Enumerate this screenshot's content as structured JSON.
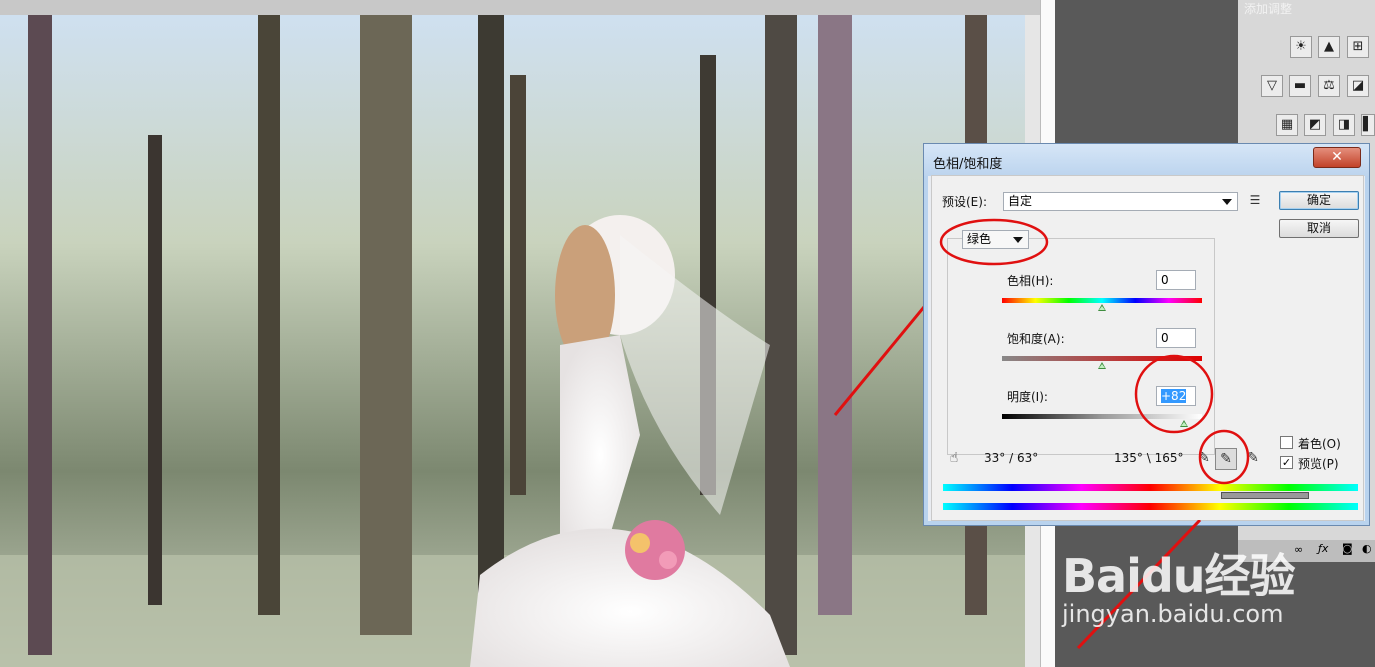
{
  "panel": {
    "title": "添加调整"
  },
  "dialog": {
    "title": "色相/饱和度",
    "close_icon": "✕",
    "preset_label": "预设(E):",
    "preset_value": "自定",
    "ok_label": "确定",
    "cancel_label": "取消",
    "channel_value": "绿色",
    "hue_label": "色相(H):",
    "hue_value": "0",
    "saturation_label": "饱和度(A):",
    "saturation_value": "0",
    "lightness_label": "明度(I):",
    "lightness_value": "+82",
    "hue_pos": 0.5,
    "saturation_pos": 0.5,
    "lightness_pos": 0.91,
    "range_left": "33° / 63°",
    "range_right": "135° \\ 165°",
    "colorize_label": "着色(O)",
    "preview_label": "预览(P)",
    "preview_checked": "✓"
  },
  "watermark": {
    "logo": "Baidu经验",
    "url": "jingyan.baidu.com"
  }
}
